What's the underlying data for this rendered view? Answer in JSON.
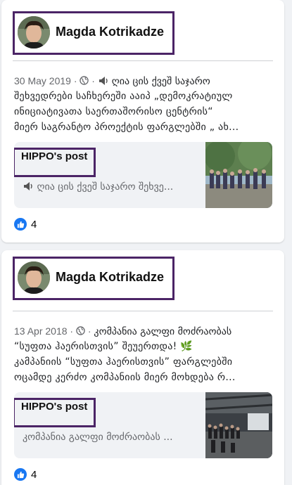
{
  "posts": [
    {
      "author": "Magda Kotrikadze",
      "date": "30 May 2019",
      "separator": "·",
      "lines": [
        "ღია ცის ქვეშ საჯარო",
        "შეხვედრები საჩხერეში ააიპ „დემოკრატიულ",
        "ინიციატივათა საერთაშორისო ცენტრის“",
        "მიერ საგრანტო პროექტის ფარგლებში „ ახ..."
      ],
      "shared": {
        "title": "HIPPO's post",
        "snippet": "ღია ცის ქვეშ საჯარო შეხვე..."
      },
      "reaction_count": "4",
      "icons": {
        "privacy": "globe-icon",
        "emoji": "speaker-icon",
        "reaction": "like-icon"
      }
    },
    {
      "author": "Magda Kotrikadze",
      "date": "13 Apr 2018",
      "separator": "·",
      "lines": [
        "კომპანია გალფი მოძრაობას",
        "“სუფთა ჰაერისთვის” შეუერთდა! 🌿",
        "კამპანიის “სუფთა ჰაერისთვის” ფარგლებში",
        "ოცამდე კერძო კომპანიის მიერ მოხდება რ..."
      ],
      "shared": {
        "title": "HIPPO's post",
        "snippet": "კომპანია გალფი მოძრაობას ..."
      },
      "reaction_count": "4",
      "icons": {
        "privacy": "globe-icon",
        "emoji": "herb-icon",
        "reaction": "like-icon"
      }
    }
  ],
  "colors": {
    "highlight": "#4b2466",
    "like": "#1877f2",
    "secondary_text": "#65676b"
  }
}
